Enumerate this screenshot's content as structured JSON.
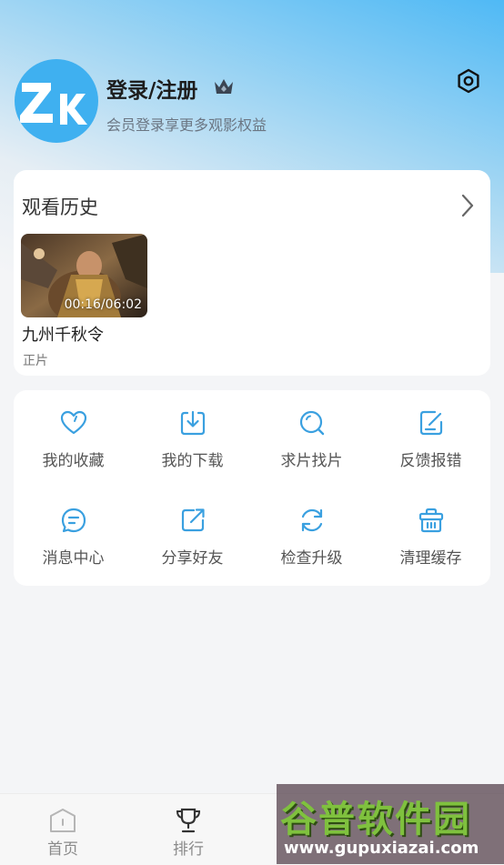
{
  "profile": {
    "avatar_text": "ZK",
    "name": "登录/注册",
    "subtitle": "会员登录享更多观影权益"
  },
  "history": {
    "title": "观看历史",
    "items": [
      {
        "title": "九州千秋令",
        "time": "00:16/06:02",
        "tag": "正片"
      }
    ]
  },
  "menu": [
    {
      "label": "我的收藏",
      "icon": "heart-icon"
    },
    {
      "label": "我的下载",
      "icon": "download-icon"
    },
    {
      "label": "求片找片",
      "icon": "search-icon"
    },
    {
      "label": "反馈报错",
      "icon": "feedback-icon"
    },
    {
      "label": "消息中心",
      "icon": "message-icon"
    },
    {
      "label": "分享好友",
      "icon": "share-icon"
    },
    {
      "label": "检查升级",
      "icon": "refresh-icon"
    },
    {
      "label": "清理缓存",
      "icon": "basket-icon"
    }
  ],
  "tabs": [
    {
      "label": "首页",
      "icon": "home-icon"
    },
    {
      "label": "排行",
      "icon": "trophy-icon"
    }
  ],
  "watermark": {
    "title": "谷普软件园",
    "url": "www.gupuxiazai.com"
  },
  "colors": {
    "accent": "#3aa0e0",
    "top_gradient": "#4fb9f5",
    "background": "#f4f5f7"
  }
}
